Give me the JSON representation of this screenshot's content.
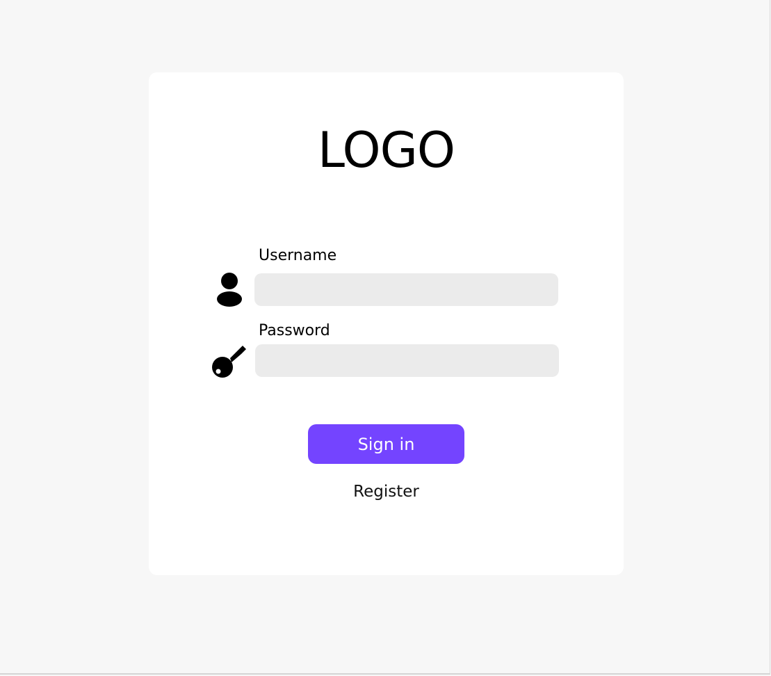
{
  "brand": {
    "logo_text": "LOGO"
  },
  "form": {
    "username": {
      "label": "Username",
      "value": "",
      "placeholder": "",
      "icon": "user-icon"
    },
    "password": {
      "label": "Password",
      "value": "",
      "placeholder": "",
      "icon": "key-icon"
    },
    "signin_label": "Sign in",
    "register_label": "Register"
  },
  "colors": {
    "page_background": "#f7f7f7",
    "card_background": "#ffffff",
    "input_background": "#ebebeb",
    "accent": "#7444ff",
    "button_text": "#ffffff",
    "text": "#000000"
  }
}
